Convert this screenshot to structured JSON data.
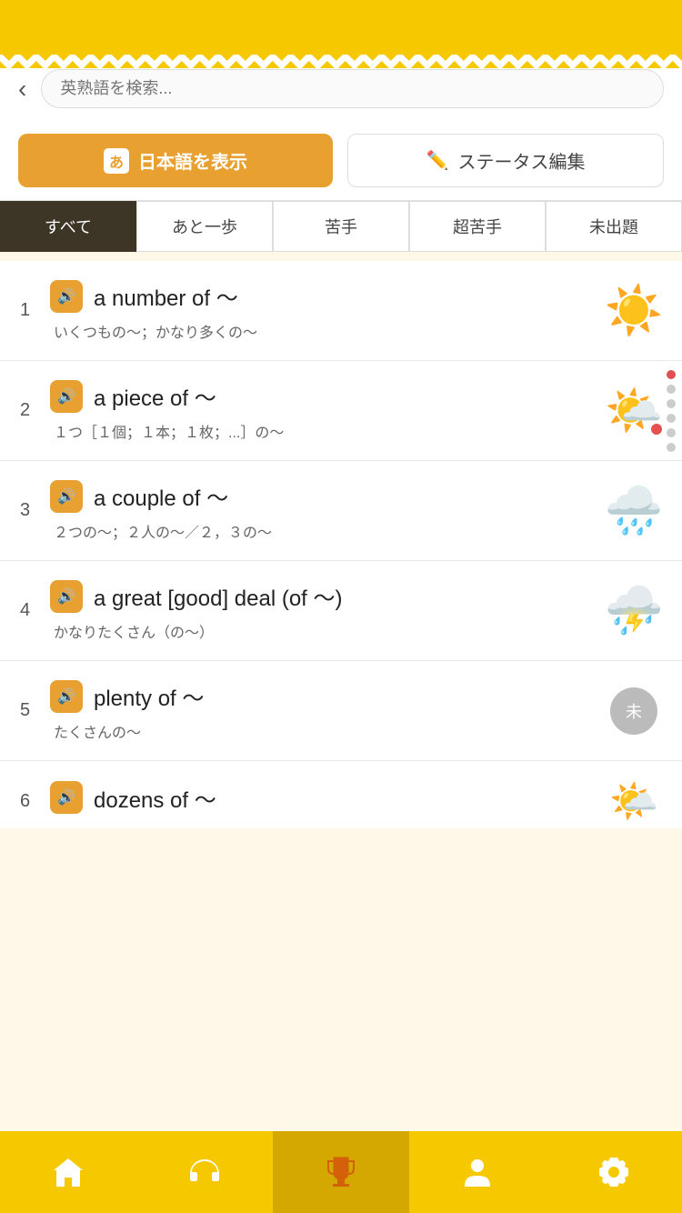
{
  "header": {
    "search_placeholder": "英熟語を検索...",
    "back_label": "‹"
  },
  "buttons": {
    "japanese_label": "日本語を表示",
    "japanese_icon": "あ",
    "status_label": "ステータス編集"
  },
  "tabs": [
    {
      "label": "すべて",
      "active": true
    },
    {
      "label": "あと一歩",
      "active": false
    },
    {
      "label": "苦手",
      "active": false
    },
    {
      "label": "超苦手",
      "active": false
    },
    {
      "label": "未出題",
      "active": false
    }
  ],
  "items": [
    {
      "number": "1",
      "phrase": "a number of 〜",
      "meaning": "いくつもの〜；かなり多くの〜",
      "status": "sunny",
      "status_icon": "☀️"
    },
    {
      "number": "2",
      "phrase": "a piece of 〜",
      "meaning": "１つ［１個；１本；１枚；...］の〜",
      "status": "cloudy-sun",
      "status_icon": "⛅"
    },
    {
      "number": "3",
      "phrase": "a couple of 〜",
      "meaning": "２つの〜；２人の〜／２，３の〜",
      "status": "rainy",
      "status_icon": "🌧️"
    },
    {
      "number": "4",
      "phrase": "a great [good] deal (of 〜)",
      "meaning": "かなりたくさん（の〜）",
      "status": "thunder",
      "status_icon": "⛈️"
    },
    {
      "number": "5",
      "phrase": "plenty of 〜",
      "meaning": "たくさんの〜",
      "status": "unread",
      "status_icon": "未"
    },
    {
      "number": "6",
      "phrase": "dozens of 〜",
      "meaning": "",
      "status": "partial",
      "status_icon": "🌤️"
    }
  ],
  "nav": {
    "items": [
      {
        "label": "home",
        "icon": "🏠"
      },
      {
        "label": "headphones",
        "icon": "🎧"
      },
      {
        "label": "trophy",
        "icon": "🏆"
      },
      {
        "label": "person",
        "icon": "👤"
      },
      {
        "label": "gear",
        "icon": "⚙️"
      }
    ]
  }
}
